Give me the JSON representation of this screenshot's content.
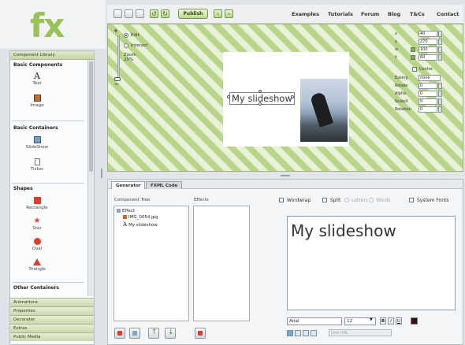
{
  "logo": {
    "text": "fx"
  },
  "toolbar": {
    "publish_label": "Publish",
    "nav": [
      "Examples",
      "Tutorials",
      "Forum",
      "Blog",
      "T&Cs",
      "Contact"
    ]
  },
  "library": {
    "header": "Component Library",
    "sections": [
      {
        "title": "Basic Components",
        "items": [
          "Text",
          "Image"
        ]
      },
      {
        "title": "Basic Containers",
        "items": [
          "SlideShow",
          "Ticker"
        ]
      },
      {
        "title": "Shapes",
        "items": [
          "Rectangle",
          "Star",
          "Oval",
          "Triangle"
        ]
      },
      {
        "title": "Other Containers",
        "items": []
      }
    ],
    "accordion": [
      "Animations",
      "Properties",
      "Decorator",
      "Extras",
      "Public Media"
    ]
  },
  "canvas": {
    "edit_label": "Edit",
    "interact_label": "Interact",
    "zoom_label": "Zoom 25%",
    "slide_text": "My slideshow",
    "properties": [
      {
        "label": "x",
        "value": "40"
      },
      {
        "label": "y",
        "value": "270"
      },
      {
        "label": "w",
        "value": "100"
      },
      {
        "label": "h",
        "value": "60"
      }
    ],
    "centre_label": "Centre",
    "more_properties": [
      {
        "label": "Easing",
        "value": "none"
      },
      {
        "label": "Rotate",
        "value": "0"
      },
      {
        "label": "Alpha",
        "value": "0"
      },
      {
        "label": "ScaleX",
        "value": "0"
      },
      {
        "label": "Rotation",
        "value": "0"
      }
    ]
  },
  "bottom": {
    "tabs": [
      "Generator",
      "FXML Code"
    ],
    "component_tree_title": "Component Tree",
    "effects_title": "Effects",
    "tree": [
      "Effect",
      "IMG_0054.jpg",
      "My slideshow"
    ],
    "options": {
      "wordwrap": "Wordwrap",
      "split": "Split",
      "letters": "Letters",
      "words": "Words",
      "system_fonts": "System Fonts"
    },
    "preview_text": "My slideshow",
    "font_family": "Arial",
    "font_size": "12",
    "bold": "B",
    "italic": "I",
    "underline": "U",
    "url_placeholder": "Link URL"
  },
  "colors": {
    "accent": "#9bc25a",
    "text_color": "#3a0f14"
  }
}
